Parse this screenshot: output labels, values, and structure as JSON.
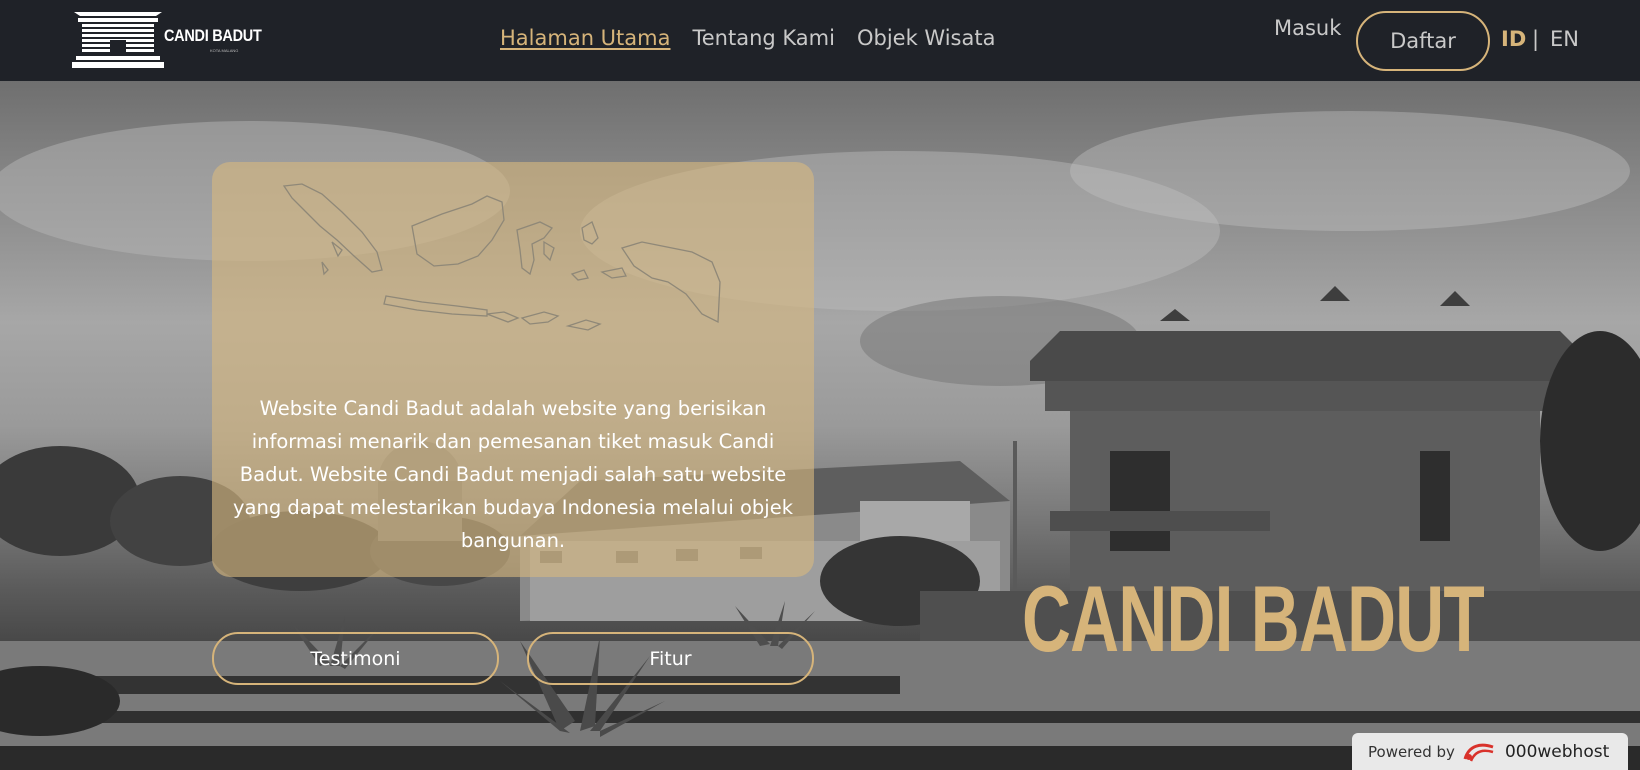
{
  "brand": {
    "name": "CANDI BADUT",
    "tagline": "KOTA MALANG"
  },
  "nav": {
    "links": [
      {
        "label": "Halaman Utama",
        "active": true
      },
      {
        "label": "Tentang Kami",
        "active": false
      },
      {
        "label": "Objek Wisata",
        "active": false
      }
    ],
    "login_label": "Masuk",
    "register_label": "Daftar",
    "lang_id": "ID",
    "lang_separator": "|",
    "lang_en": "EN"
  },
  "hero": {
    "description": "Website Candi Badut adalah website yang berisikan informasi menarik dan pemesanan tiket masuk Candi Badut. Website Candi Badut menjadi salah satu website yang dapat melestarikan budaya Indonesia melalui objek bangunan.",
    "buttons": {
      "testimoni": "Testimoni",
      "fitur": "Fitur"
    },
    "title": "CANDI BADUT"
  },
  "footer_badge": {
    "label": "Powered by",
    "brand": "000webhost"
  },
  "colors": {
    "accent": "#d6b47a",
    "navbar": "#1f2228",
    "card": "#d6b880"
  }
}
